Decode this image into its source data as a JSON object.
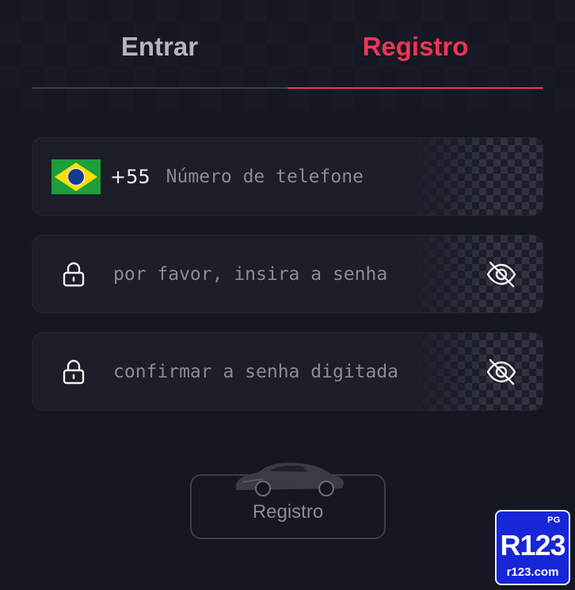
{
  "tabs": [
    {
      "label": "Entrar",
      "active": false
    },
    {
      "label": "Registro",
      "active": true
    }
  ],
  "phone": {
    "country_code": "+55",
    "flag": "brazil-flag",
    "placeholder": "Número de telefone",
    "value": ""
  },
  "password": {
    "placeholder": "por favor, insira a senha",
    "value": "",
    "icon": "lock-icon",
    "toggle_icon": "eye-off-icon"
  },
  "confirm_password": {
    "placeholder": "confirmar a senha digitada",
    "value": "",
    "icon": "lock-icon",
    "toggle_icon": "eye-off-icon"
  },
  "submit": {
    "label": "Registro",
    "icon": "car-icon"
  },
  "badge": {
    "tag": "PG",
    "brand": "R123",
    "site": "r123.com"
  },
  "colors": {
    "accent": "#ef3554",
    "background": "#151722",
    "field": "#1c1e2a",
    "badge": "#1626d8"
  }
}
